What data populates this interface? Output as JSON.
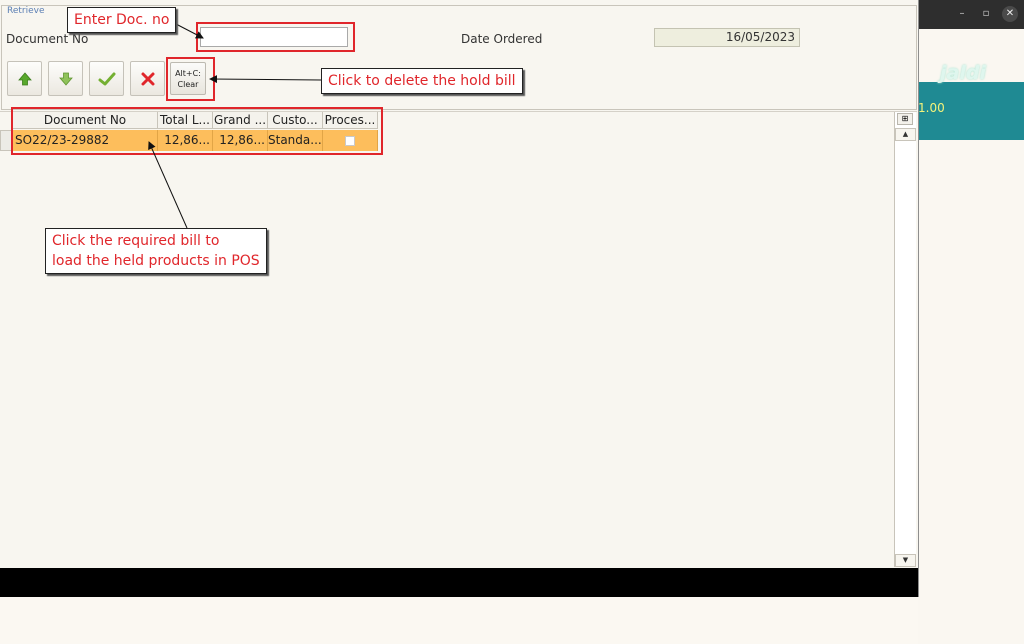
{
  "panel": {
    "legend": "Retrieve",
    "document_no_label": "Document No",
    "document_no_value": "",
    "date_ordered_label": "Date Ordered",
    "date_ordered_value": "16/05/2023"
  },
  "toolbar": {
    "up_icon": "arrow-up-icon",
    "down_icon": "arrow-down-icon",
    "ok_icon": "check-icon",
    "cancel_icon": "x-icon",
    "clear_shortcut": "Alt+C:",
    "clear_label": "Clear"
  },
  "grid": {
    "columns": [
      "Document No",
      "Total L...",
      "Grand ...",
      "Custo...",
      "Proces..."
    ],
    "rows": [
      {
        "document_no": "SO22/23-29882",
        "total_lines": "12,86...",
        "grand_total": "12,86...",
        "customer": "Standa...",
        "processed": false
      }
    ]
  },
  "background_window": {
    "logo": "jaldi",
    "value": "1.00",
    "minimize": "–",
    "maximize": "▫",
    "close": "✕"
  },
  "annotations": {
    "enter_doc": "Enter Doc. no",
    "delete_hold": "Click to delete the hold bill",
    "click_bill_line1": "Click the required bill to",
    "click_bill_line2": "load the held products in POS"
  },
  "colors": {
    "selected_row": "#fdbe5c",
    "annotation_red": "#e0262b",
    "teal": "#1f8a93"
  }
}
